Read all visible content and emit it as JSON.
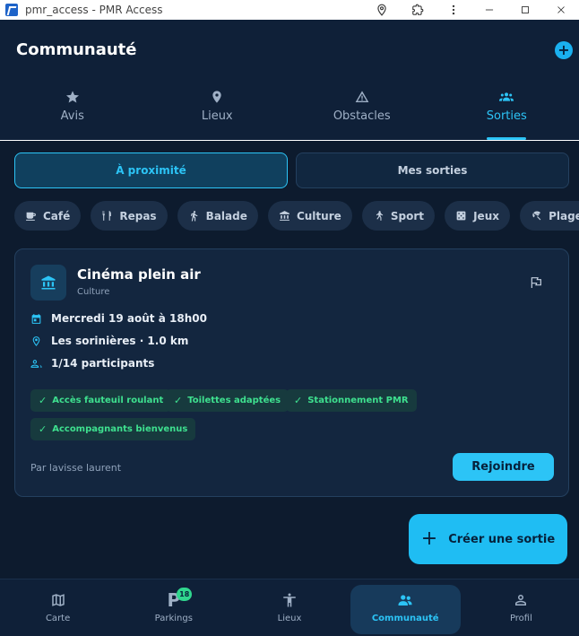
{
  "window": {
    "title": "pmr_access - PMR Access"
  },
  "header": {
    "title": "Communauté"
  },
  "tabs": [
    {
      "label": "Avis",
      "icon": "star-icon"
    },
    {
      "label": "Lieux",
      "icon": "map-pin-icon"
    },
    {
      "label": "Obstacles",
      "icon": "warning-icon"
    },
    {
      "label": "Sorties",
      "icon": "group-icon",
      "active": true
    }
  ],
  "segments": {
    "nearby": "À proximité",
    "mine": "Mes sorties"
  },
  "chips": [
    {
      "label": "Café",
      "icon": "coffee-icon"
    },
    {
      "label": "Repas",
      "icon": "restaurant-icon"
    },
    {
      "label": "Balade",
      "icon": "walk-icon"
    },
    {
      "label": "Culture",
      "icon": "museum-icon"
    },
    {
      "label": "Sport",
      "icon": "sport-icon"
    },
    {
      "label": "Jeux",
      "icon": "dice-icon"
    },
    {
      "label": "Plage",
      "icon": "beach-icon"
    },
    {
      "label": "",
      "icon": "basket-icon"
    }
  ],
  "card": {
    "title": "Cinéma plein air",
    "category": "Culture",
    "date": "Mercredi 19 août à 18h00",
    "location": "Les sorinières · 1.0 km",
    "participants": "1/14 participants",
    "badges": [
      "Accès fauteuil roulant",
      "Toilettes adaptées",
      "Stationnement PMR",
      "Accompagnants bienvenus"
    ],
    "author": "Par lavisse laurent",
    "join_label": "Rejoindre"
  },
  "create_label": "Créer une sortie",
  "bottom_nav": [
    {
      "label": "Carte",
      "icon": "map-icon"
    },
    {
      "label": "Parkings",
      "icon": "parking-icon",
      "badge": "18"
    },
    {
      "label": "Lieux",
      "icon": "accessibility-icon"
    },
    {
      "label": "Communauté",
      "icon": "group-icon",
      "active": true
    },
    {
      "label": "Profil",
      "icon": "person-icon"
    }
  ],
  "colors": {
    "accent": "#2cc4f6",
    "success": "#3ee08f",
    "background": "#0d1b2e"
  }
}
